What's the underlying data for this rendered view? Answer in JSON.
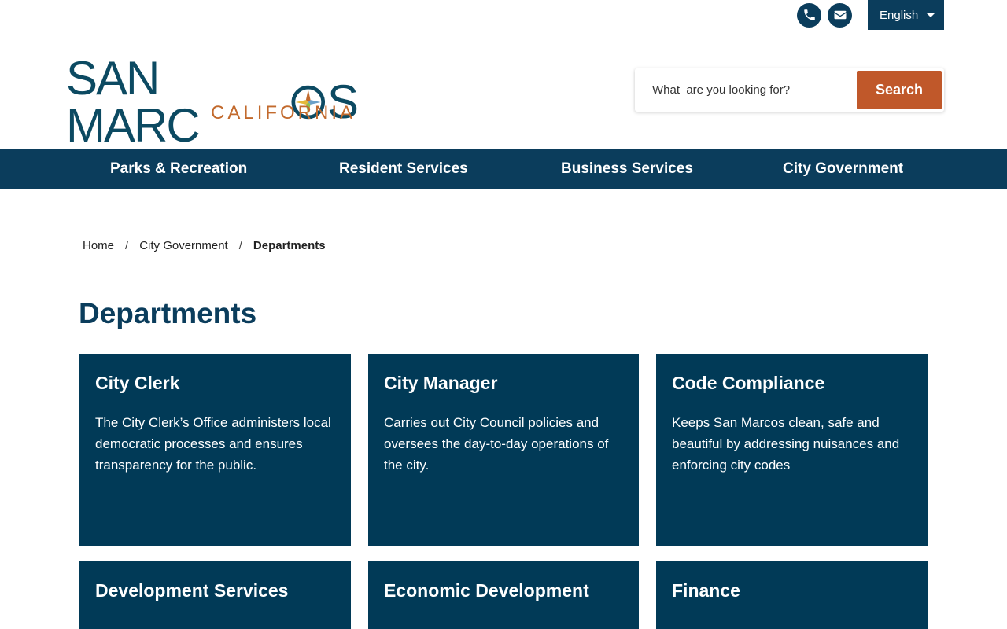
{
  "utility": {
    "language": "English",
    "phone_icon": "phone-icon",
    "email_icon": "envelope-icon"
  },
  "logo": {
    "main_left": "SAN MARC",
    "main_right": "S",
    "sub": "CALIFORNIA"
  },
  "search": {
    "placeholder": "What  are you looking for?",
    "button": "Search"
  },
  "nav": [
    "Parks & Recreation",
    "Resident Services",
    "Business Services",
    "City Government"
  ],
  "breadcrumb": {
    "home": "Home",
    "sep": "/",
    "parent": "City Government",
    "current": "Departments"
  },
  "page_title": "Departments",
  "cards": [
    {
      "title": "City Clerk",
      "desc": "The City Clerk’s Office administers local democratic processes and ensures transparency for the public."
    },
    {
      "title": "City Manager",
      "desc": "Carries out City Council policies and oversees the day-to-day operations of the city."
    },
    {
      "title": "Code Compliance",
      "desc": "Keeps San Marcos clean, safe and beautiful by addressing nuisances and enforcing city codes"
    },
    {
      "title": "Development Services",
      "desc": ""
    },
    {
      "title": "Economic Development",
      "desc": ""
    },
    {
      "title": "Finance",
      "desc": ""
    }
  ],
  "colors": {
    "primary": "#0b3d5c",
    "accent": "#c0582a",
    "card": "#013a57"
  }
}
